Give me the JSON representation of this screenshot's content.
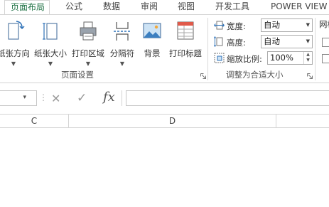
{
  "tabs": [
    {
      "label": "页面布局",
      "active": true
    },
    {
      "label": "公式"
    },
    {
      "label": "数据"
    },
    {
      "label": "审阅"
    },
    {
      "label": "视图"
    },
    {
      "label": "开发工具"
    },
    {
      "label": "POWER VIEW"
    }
  ],
  "page_setup": {
    "buttons": [
      {
        "label": "纸张方向",
        "icon": "orientation-icon"
      },
      {
        "label": "纸张大小",
        "icon": "paper-size-icon"
      },
      {
        "label": "打印区域",
        "icon": "print-area-icon"
      },
      {
        "label": "分隔符",
        "icon": "breaks-icon"
      },
      {
        "label": "背景",
        "icon": "background-icon"
      },
      {
        "label": "打印标题",
        "icon": "print-titles-icon"
      }
    ],
    "group_label": "页面设置"
  },
  "scale_to_fit": {
    "width_label": "宽度:",
    "width_value": "自动",
    "height_label": "高度:",
    "height_value": "自动",
    "scale_label": "缩放比例:",
    "scale_value": "100%",
    "group_label": "调整为合适大小"
  },
  "sheet_options": {
    "label_partial": "网格"
  },
  "formula_bar": {
    "fx_label": "fx",
    "cancel_symbol": "✕",
    "enter_symbol": "✓",
    "namebox_dropdown": "▾",
    "separator": "⋮"
  },
  "columns": [
    {
      "label": "C"
    },
    {
      "label": "D"
    }
  ],
  "colors": {
    "accent": "#217346"
  }
}
